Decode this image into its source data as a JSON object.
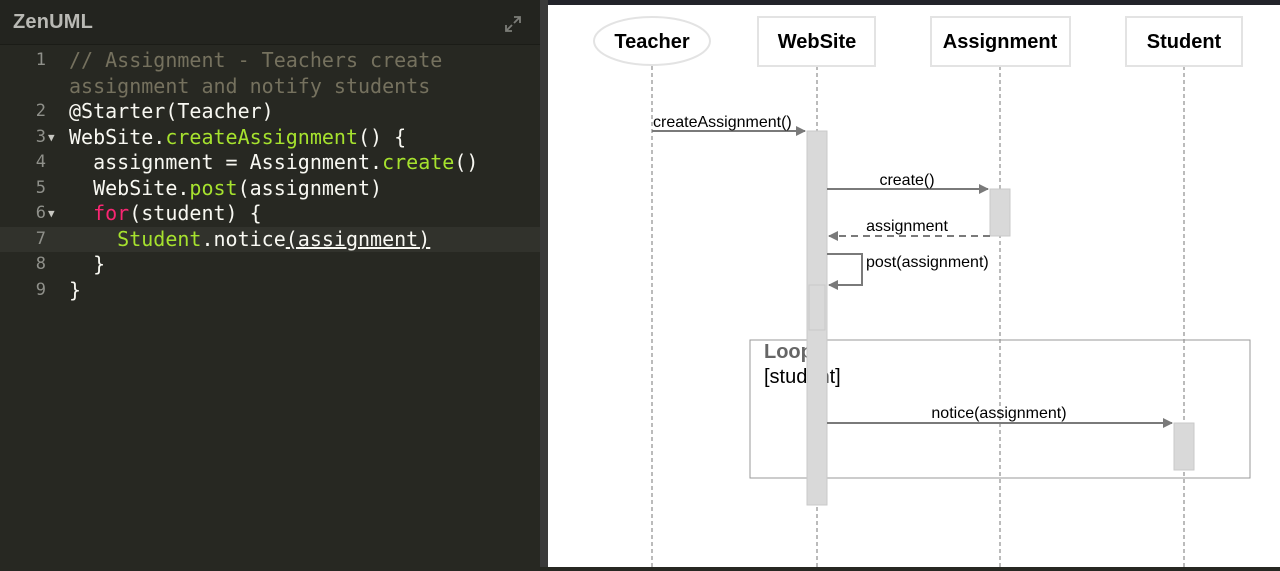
{
  "app": {
    "title": "ZenUML"
  },
  "editor": {
    "lines": [
      {
        "num": "1",
        "fold": false,
        "text": "// Assignment - Teachers create"
      },
      {
        "num": "",
        "fold": false,
        "text": "assignment and notify students"
      },
      {
        "num": "2",
        "fold": false,
        "text": "@Starter(Teacher)"
      },
      {
        "num": "3",
        "fold": true,
        "text": "WebSite.createAssignment() {"
      },
      {
        "num": "4",
        "fold": false,
        "text": "  assignment = Assignment.create()"
      },
      {
        "num": "5",
        "fold": false,
        "text": "  WebSite.post(assignment)"
      },
      {
        "num": "6",
        "fold": true,
        "text": "  for(student) {"
      },
      {
        "num": "7",
        "fold": false,
        "text": "    Student.notice(assignment)"
      },
      {
        "num": "8",
        "fold": false,
        "text": "  }"
      },
      {
        "num": "9",
        "fold": false,
        "text": "}"
      }
    ],
    "active_line": "7"
  },
  "diagram": {
    "participants": [
      "Teacher",
      "WebSite",
      "Assignment",
      "Student"
    ],
    "starter": "Teacher",
    "messages": [
      {
        "label": "createAssignment()",
        "from": "Teacher",
        "to": "WebSite",
        "kind": "sync"
      },
      {
        "label": "create()",
        "from": "WebSite",
        "to": "Assignment",
        "kind": "sync"
      },
      {
        "label": "assignment",
        "from": "Assignment",
        "to": "WebSite",
        "kind": "return"
      },
      {
        "label": "post(assignment)",
        "from": "WebSite",
        "to": "WebSite",
        "kind": "self"
      },
      {
        "label": "notice(assignment)",
        "from": "WebSite",
        "to": "Student",
        "kind": "sync"
      }
    ],
    "fragment": {
      "type": "Loop",
      "condition": "[student]"
    },
    "colors": {
      "editor_bg": "#272822",
      "comment": "#75715e",
      "function": "#a6e22e",
      "keyword": "#f92672",
      "arrow": "#777777",
      "activation": "#d9d9d9"
    }
  }
}
